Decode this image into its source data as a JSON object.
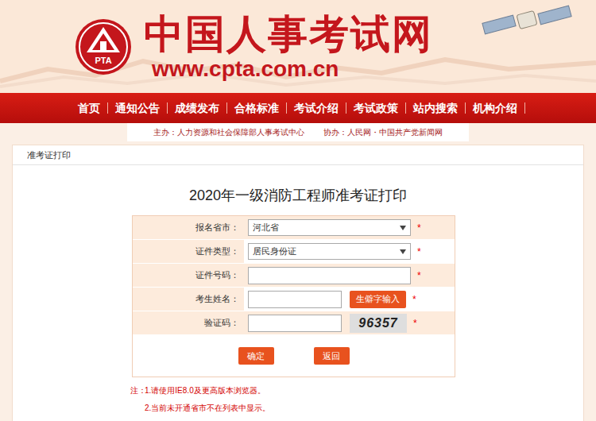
{
  "header": {
    "logo_text": "PTA",
    "site_name": "中国人事考试网",
    "url": "www.cpta.com.cn"
  },
  "nav": [
    "首页",
    "通知公告",
    "成绩发布",
    "合格标准",
    "考试介绍",
    "考试政策",
    "站内搜索",
    "机构介绍"
  ],
  "sponsors": {
    "host": "主办：人力资源和社会保障部人事考试中心",
    "co_host": "协办：人民网・中国共产党新闻网"
  },
  "breadcrumb": "准考证打印",
  "title": "2020年一级消防工程师准考证打印",
  "form": {
    "fields": [
      {
        "label": "报名省市：",
        "kind": "select",
        "value": "河北省",
        "required": "*"
      },
      {
        "label": "证件类型：",
        "kind": "select",
        "value": "居民身份证",
        "required": "*"
      },
      {
        "label": "证件号码：",
        "kind": "input",
        "value": "",
        "required": "*"
      },
      {
        "label": "考生姓名：",
        "kind": "input_button",
        "value": "",
        "button": "生僻字输入",
        "required": "*"
      },
      {
        "label": "验证码：",
        "kind": "input_captcha",
        "value": "",
        "captcha": "96357",
        "required": "*"
      }
    ],
    "buttons": [
      "确定",
      "返回"
    ]
  },
  "notes": {
    "prefix": "注：",
    "items": [
      "1.请使用IE8.0及更高版本浏览器。",
      "2.当前未开通省市不在列表中显示。"
    ]
  }
}
